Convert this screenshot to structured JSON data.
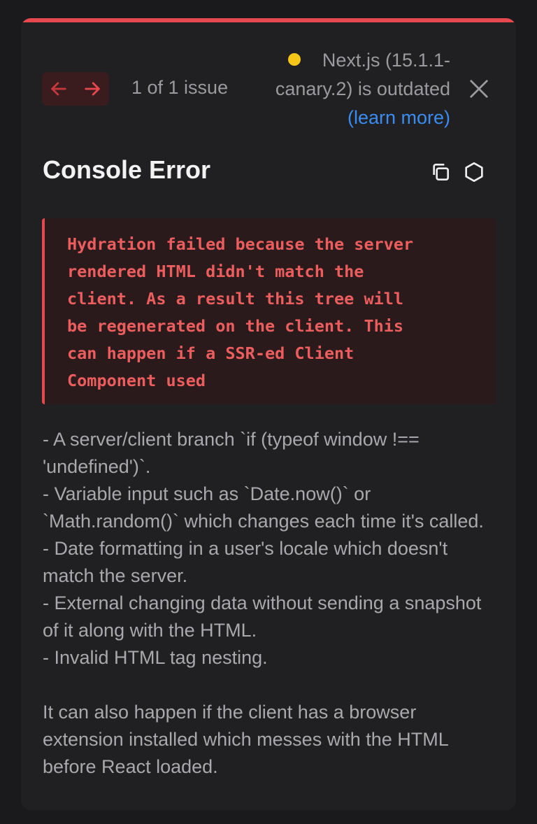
{
  "header": {
    "issue_count": "1 of 1 issue",
    "version_line1": "Next.js (15.1.1-",
    "version_line2": "canary.2) is outdated",
    "learn_more": "(learn more)",
    "prev_icon": "arrow-left-icon",
    "next_icon": "arrow-right-icon",
    "close_icon": "close-icon",
    "status_color": "#f5c518"
  },
  "title": {
    "text": "Console Error",
    "copy_icon": "copy-icon",
    "nodejs_icon": "hexagon-icon"
  },
  "error": {
    "message": "Hydration failed because the server\nrendered HTML didn't match the\nclient. As a result this tree will\nbe regenerated on the client. This\ncan happen if a SSR-ed Client\nComponent used"
  },
  "details": {
    "lines": [
      "- A server/client branch `if (typeof window !== 'undefined')`.",
      "- Variable input such as `Date.now()` or `Math.random()` which changes each time it's called.",
      "- Date formatting in a user's locale which doesn't match the server.",
      "- External changing data without sending a snapshot of it along with the HTML.",
      "- Invalid HTML tag nesting."
    ],
    "footer": "It can also happen if the client has a browser extension installed which messes with the HTML before React loaded."
  },
  "colors": {
    "accent": "#e5484d",
    "link": "#3b8cf0",
    "background": "#202022"
  }
}
